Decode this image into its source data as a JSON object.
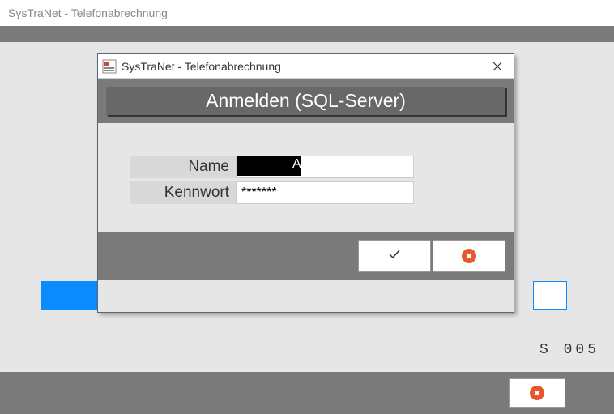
{
  "main_window": {
    "title": "SysTraNet - Telefonabrechnung",
    "bottom_text": "S 005"
  },
  "login_dialog": {
    "title": "SysTraNet - Telefonabrechnung",
    "banner": "Anmelden (SQL-Server)",
    "name_label": "Name",
    "name_value": "",
    "password_label": "Kennwort",
    "password_value": "*******"
  }
}
